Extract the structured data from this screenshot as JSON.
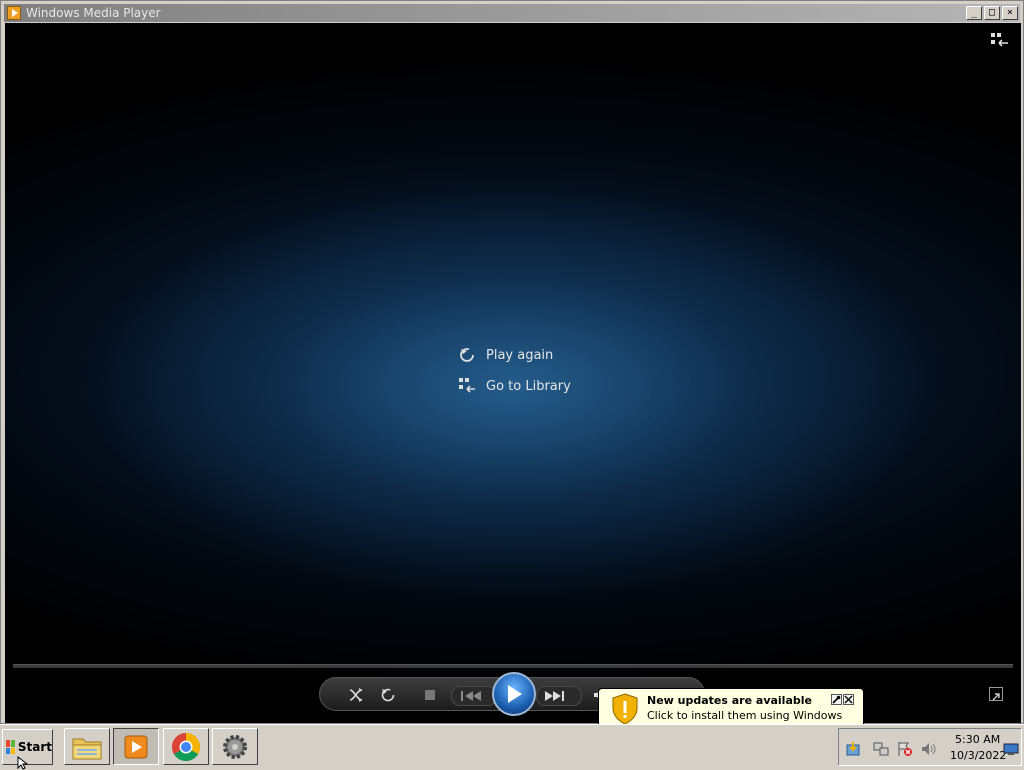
{
  "window": {
    "title": "Windows Media Player",
    "controls": [
      "minimize-icon",
      "maximize-icon",
      "close-icon"
    ]
  },
  "player": {
    "menu": [
      {
        "label": "Play again",
        "icon": "replay-icon"
      },
      {
        "label": "Go to Library",
        "icon": "library-icon"
      }
    ],
    "controls": [
      "shuffle-icon",
      "repeat-icon",
      "stop-icon",
      "previous-icon",
      "play-icon",
      "next-icon",
      "volume-icon",
      "fullscreen-icon",
      "switch-to-library-icon"
    ],
    "accent": "#1c5fb0"
  },
  "notification": {
    "title": "New updates are available",
    "text": "Click to install them using Windows Update.",
    "icon": "warning-shield-icon",
    "bg": "#ffffe1"
  },
  "taskbar": {
    "start_label": "Start",
    "apps": [
      "file-explorer-icon",
      "media-player-icon",
      "chrome-icon",
      "settings-gear-icon"
    ],
    "tray_icons": [
      "update-icon",
      "network-icon",
      "flag-error-icon",
      "volume-icon",
      "show-desktop-icon"
    ],
    "clock": {
      "time": "5:30 AM",
      "date": "10/3/2022"
    }
  }
}
